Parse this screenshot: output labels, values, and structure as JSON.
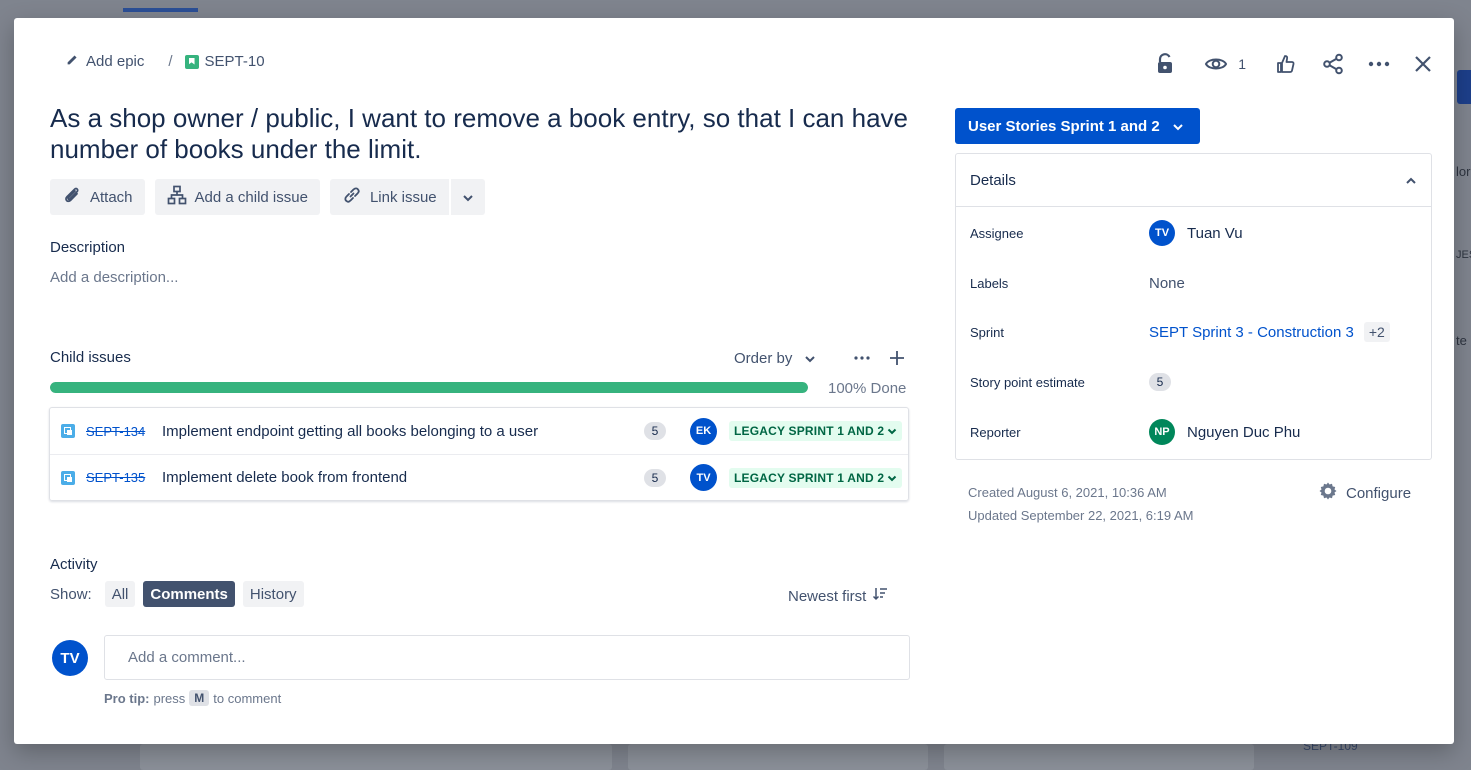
{
  "background": {
    "peek_texts": [
      "lor",
      "JES",
      "te",
      "SEPT-109"
    ]
  },
  "breadcrumb": {
    "epic_label": "Add epic",
    "separator": "/",
    "issue_key": "SEPT-10"
  },
  "header_actions": {
    "watch_count": "1"
  },
  "issue": {
    "title": "As a shop owner / public, I want to remove a book entry, so that I can have number of books under the limit.",
    "toolbar": {
      "attach": "Attach",
      "add_child": "Add a child issue",
      "link_issue": "Link issue"
    },
    "description_label": "Description",
    "description_placeholder": "Add a description..."
  },
  "child_issues": {
    "label": "Child issues",
    "order_by": "Order by",
    "progress_percent": 100,
    "progress_text": "100% Done",
    "items": [
      {
        "key": "SEPT-134",
        "summary": "Implement endpoint getting all books belonging to a user",
        "points": "5",
        "assignee_initials": "EK",
        "status": "LEGACY SPRINT 1 AND 2"
      },
      {
        "key": "SEPT-135",
        "summary": "Implement delete book from frontend",
        "points": "5",
        "assignee_initials": "TV",
        "status": "LEGACY SPRINT 1 AND 2"
      }
    ]
  },
  "activity": {
    "label": "Activity",
    "show_label": "Show:",
    "filters": [
      "All",
      "Comments",
      "History"
    ],
    "active_filter": "Comments",
    "sort": "Newest first",
    "me_initials": "TV",
    "comment_placeholder": "Add a comment...",
    "protip_bold": "Pro tip:",
    "protip_pre": "press",
    "protip_key": "M",
    "protip_post": "to comment"
  },
  "sidebar": {
    "status_button": "User Stories Sprint 1 and 2",
    "details_title": "Details",
    "fields": {
      "assignee_label": "Assignee",
      "assignee_initials": "TV",
      "assignee_name": "Tuan Vu",
      "labels_label": "Labels",
      "labels_value": "None",
      "sprint_label": "Sprint",
      "sprint_value": "SEPT Sprint 3 - Construction 3",
      "sprint_extra": "+2",
      "story_points_label": "Story point estimate",
      "story_points_value": "5",
      "reporter_label": "Reporter",
      "reporter_initials": "NP",
      "reporter_name": "Nguyen Duc Phu"
    },
    "created": "Created August 6, 2021, 10:36 AM",
    "updated": "Updated September 22, 2021, 6:19 AM",
    "configure": "Configure"
  },
  "colors": {
    "primary": "#0052cc",
    "success": "#36b37e",
    "reporter_avatar": "#00875a",
    "status_bg": "#e3fcef",
    "status_text": "#006644"
  }
}
